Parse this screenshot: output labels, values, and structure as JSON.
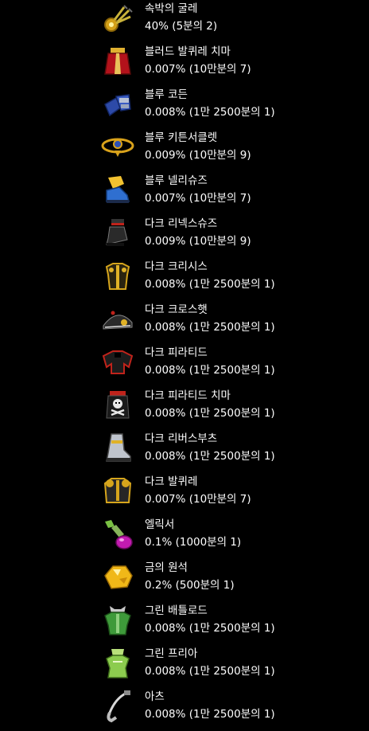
{
  "items": [
    {
      "name": "속박의 굴레",
      "rate": "40% (5분의 2)",
      "icon": "shackle-icon"
    },
    {
      "name": "블러드 발퀴레 치마",
      "rate": "0.007% (10만분의 7)",
      "icon": "red-skirt-icon"
    },
    {
      "name": "블루 코든",
      "rate": "0.008% (1만 2500분의 1)",
      "icon": "blue-gauntlet-icon"
    },
    {
      "name": "블루 키튼서클렛",
      "rate": "0.009% (10만분의 9)",
      "icon": "circlet-icon"
    },
    {
      "name": "블루 넬리슈즈",
      "rate": "0.007% (10만분의 7)",
      "icon": "blue-shoes-icon"
    },
    {
      "name": "다크 리넥스슈즈",
      "rate": "0.009% (10만분의 9)",
      "icon": "dark-shoes-icon"
    },
    {
      "name": "다크 크리시스",
      "rate": "0.008% (1만 2500분의 1)",
      "icon": "dark-armor-icon"
    },
    {
      "name": "다크 크로스햇",
      "rate": "0.008% (1만 2500분의 1)",
      "icon": "dark-hat-icon"
    },
    {
      "name": "다크 피라티드",
      "rate": "0.008% (1만 2500분의 1)",
      "icon": "dark-top-icon"
    },
    {
      "name": "다크 피라티드 치마",
      "rate": "0.008% (1만 2500분의 1)",
      "icon": "skull-skirt-icon"
    },
    {
      "name": "다크 리버스부츠",
      "rate": "0.008% (1만 2500분의 1)",
      "icon": "dark-boots-icon"
    },
    {
      "name": "다크 발퀴레",
      "rate": "0.007% (10만분의 7)",
      "icon": "dark-valkyrie-icon"
    },
    {
      "name": "엘릭서",
      "rate": "0.1% (1000분의 1)",
      "icon": "elixir-potion-icon"
    },
    {
      "name": "금의 원석",
      "rate": "0.2% (500분의 1)",
      "icon": "gold-ore-icon"
    },
    {
      "name": "그린 배틀로드",
      "rate": "0.008% (1만 2500분의 1)",
      "icon": "green-battle-armor-icon"
    },
    {
      "name": "그린 프리아",
      "rate": "0.008% (1만 2500분의 1)",
      "icon": "green-dress-icon"
    },
    {
      "name": "아츠",
      "rate": "0.008% (1만 2500분의 1)",
      "icon": "arts-weapon-icon"
    }
  ]
}
